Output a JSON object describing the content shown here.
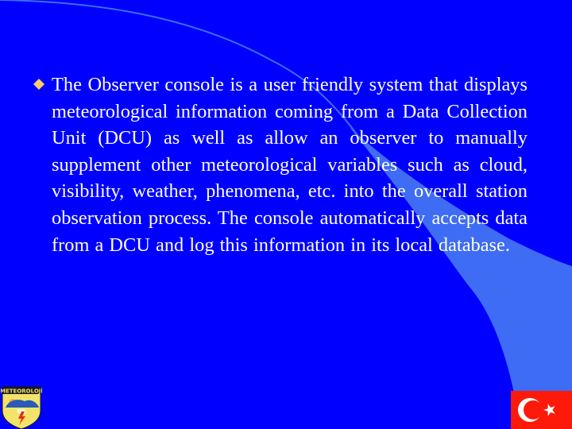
{
  "slide": {
    "background_color": "#0000fe",
    "accent_color": "#3e6cf4",
    "bullet_color": "#ffcc66",
    "text_color": "#ffffff",
    "bullet": {
      "icon": "diamond-bullet-icon",
      "text": "The Observer console is a user friendly system that displays meteorological information coming from a Data Collection Unit (DCU) as well as allow an observer to manually supplement other meteorological variables such as cloud, visibility, weather, phenomena, etc. into the overall station observation process. The console automatically accepts data from a DCU and log this information in its local database."
    },
    "logo": {
      "label": "METEOROLOJİ",
      "icon": "meteorology-emblem-icon"
    },
    "flag": {
      "icon": "turkish-flag-icon",
      "color": "#fe1a0a"
    }
  }
}
